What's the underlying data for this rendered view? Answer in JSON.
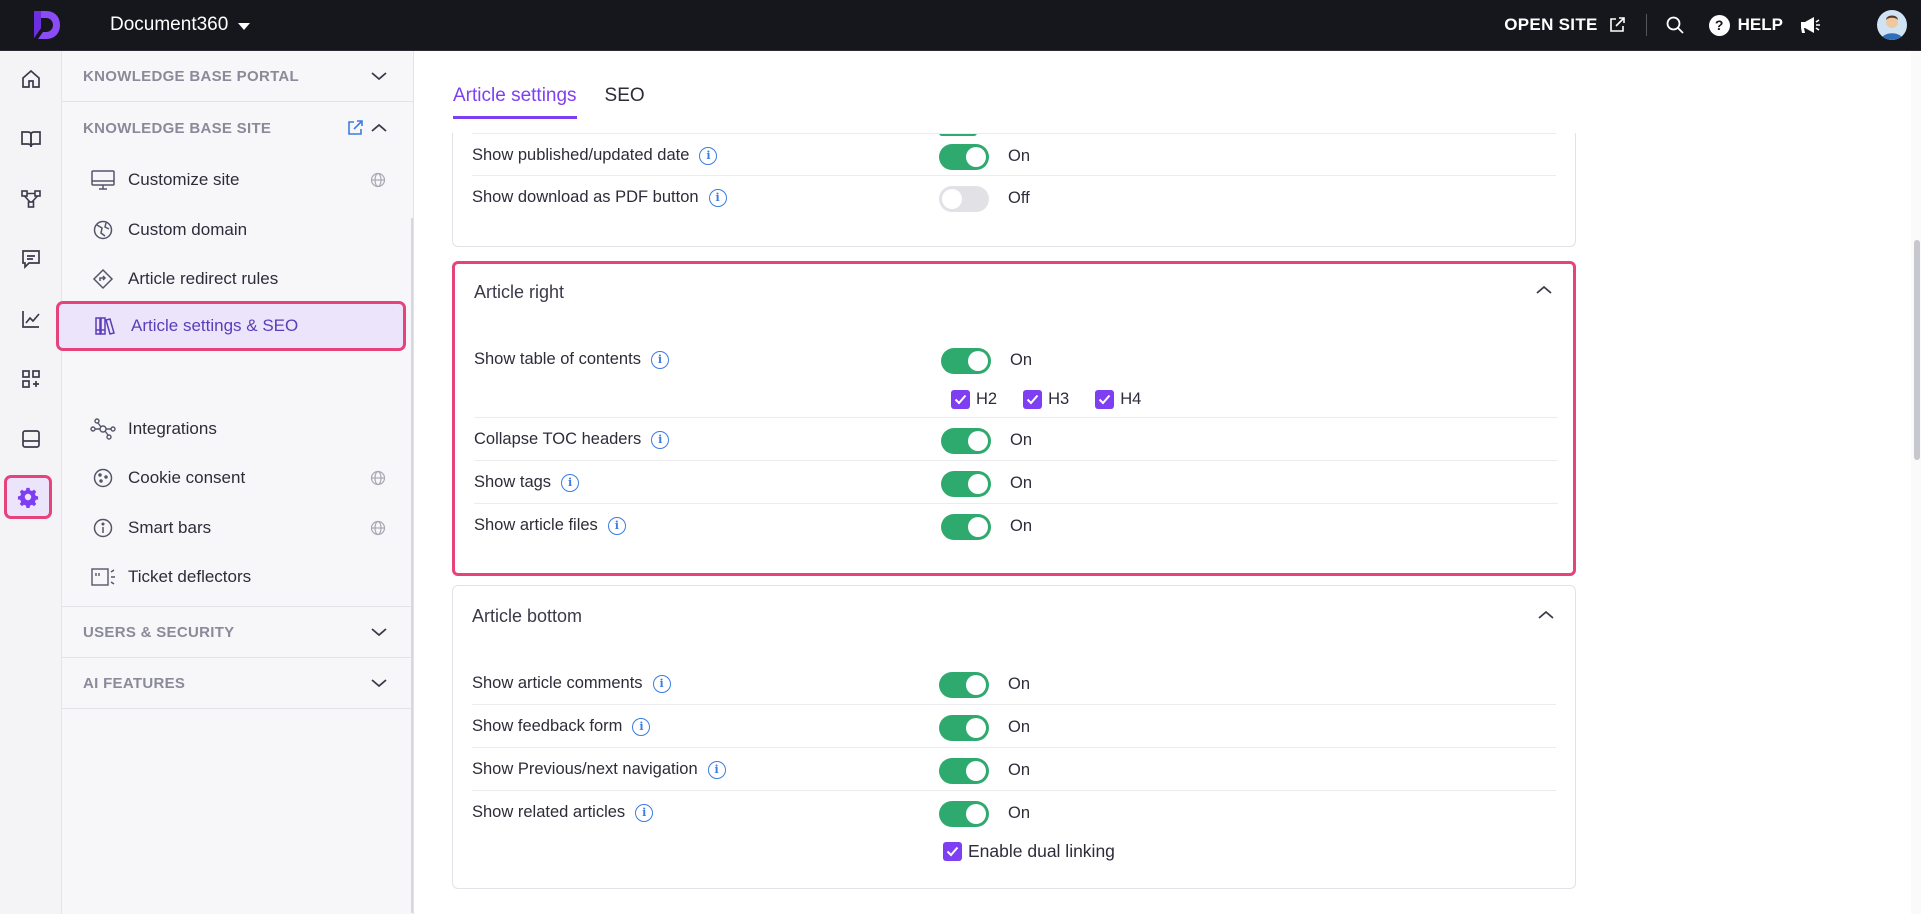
{
  "topbar": {
    "project_name": "Document360",
    "open_site_label": "OPEN SITE",
    "help_label": "HELP",
    "colors": {
      "background": "#16161d",
      "accent": "#7e3ff2"
    }
  },
  "rail": {
    "items": [
      "home-icon",
      "book-icon",
      "workflow-icon",
      "feedback-icon",
      "analytics-icon",
      "apps-icon",
      "widget-icon",
      "settings-icon"
    ],
    "active": "settings-icon"
  },
  "nav": {
    "kb_portal": "KNOWLEDGE BASE PORTAL",
    "kb_site": "KNOWLEDGE BASE SITE",
    "items": [
      {
        "label": "Customize site",
        "icon": "monitor-icon",
        "globe": true
      },
      {
        "label": "Custom domain",
        "icon": "domain-icon",
        "globe": false
      },
      {
        "label": "Article redirect rules",
        "icon": "redirect-icon",
        "globe": false
      },
      {
        "label": "Article settings & SEO",
        "icon": "books-icon",
        "globe": false,
        "active": true
      },
      {
        "label": "Integrations",
        "icon": "integrations-icon",
        "globe": false
      },
      {
        "label": "Cookie consent",
        "icon": "cookie-icon",
        "globe": true
      },
      {
        "label": "Smart bars",
        "icon": "info-icon",
        "globe": true
      },
      {
        "label": "Ticket deflectors",
        "icon": "ticket-icon",
        "globe": false
      }
    ],
    "users_security": "USERS & SECURITY",
    "ai_features": "AI FEATURES"
  },
  "tabs": {
    "article_settings": "Article settings",
    "seo": "SEO"
  },
  "top_card": {
    "rows": [
      {
        "label": "Show published/updated date",
        "state": "On",
        "on": true
      },
      {
        "label": "Show download as PDF button",
        "state": "Off",
        "on": false
      }
    ]
  },
  "article_right": {
    "title": "Article right",
    "rows": [
      {
        "label": "Show table of contents",
        "state": "On",
        "on": true
      },
      {
        "label": "Collapse TOC headers",
        "state": "On",
        "on": true
      },
      {
        "label": "Show tags",
        "state": "On",
        "on": true
      },
      {
        "label": "Show article files",
        "state": "On",
        "on": true
      }
    ],
    "headings": [
      "H2",
      "H3",
      "H4"
    ]
  },
  "article_bottom": {
    "title": "Article bottom",
    "rows": [
      {
        "label": "Show article comments",
        "state": "On",
        "on": true
      },
      {
        "label": "Show feedback form",
        "state": "On",
        "on": true
      },
      {
        "label": "Show Previous/next navigation",
        "state": "On",
        "on": true
      },
      {
        "label": "Show related articles",
        "state": "On",
        "on": true
      }
    ],
    "dual_linking_label": "Enable dual linking"
  }
}
